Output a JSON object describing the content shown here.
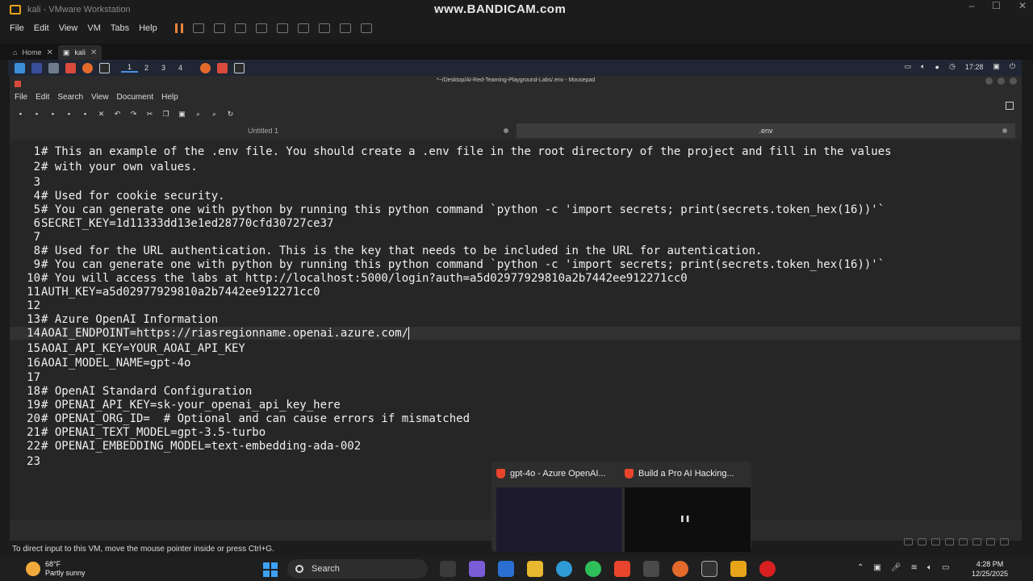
{
  "host": {
    "window_title": "kali - VMware Workstation",
    "watermark": "www.BANDICAM.com",
    "menu": [
      "File",
      "Edit",
      "View",
      "VM",
      "Tabs",
      "Help"
    ],
    "tabs": [
      {
        "label": "Home"
      },
      {
        "label": "kali"
      }
    ],
    "status_text": "To direct input to this VM, move the mouse pointer inside or press Ctrl+G."
  },
  "kali_panel": {
    "workspaces": [
      "1",
      "2",
      "3",
      "4"
    ],
    "clock": "17:28"
  },
  "mousepad": {
    "title": "*~/Desktop/AI-Red-Teaming-Playground-Labs/.env - Mousepad",
    "menu": [
      "File",
      "Edit",
      "Search",
      "View",
      "Document",
      "Help"
    ],
    "tabs": [
      {
        "label": "Untitled 1"
      },
      {
        "label": ".env"
      }
    ],
    "current_line": 14,
    "lines": [
      {
        "num": "1",
        "text": "# This an example of the .env file. You should create a .env file in the root directory of the project and fill in the values"
      },
      {
        "num": "2",
        "text": "# with your own values."
      },
      {
        "num": "3",
        "text": ""
      },
      {
        "num": "4",
        "text": "# Used for cookie security."
      },
      {
        "num": "5",
        "text": "# You can generate one with python by running this python command `python -c 'import secrets; print(secrets.token_hex(16))'`"
      },
      {
        "num": "6",
        "text": "SECRET_KEY=1d11333dd13e1ed28770cfd30727ce37"
      },
      {
        "num": "7",
        "text": ""
      },
      {
        "num": "8",
        "text": "# Used for the URL authentication. This is the key that needs to be included in the URL for autentication."
      },
      {
        "num": "9",
        "text": "# You can generate one with python by running this python command `python -c 'import secrets; print(secrets.token_hex(16))'`"
      },
      {
        "num": "10",
        "text": "# You will access the labs at http://localhost:5000/login?auth=a5d02977929810a2b7442ee912271cc0"
      },
      {
        "num": "11",
        "text": "AUTH_KEY=a5d02977929810a2b7442ee912271cc0"
      },
      {
        "num": "12",
        "text": ""
      },
      {
        "num": "13",
        "text": "# Azure OpenAI Information"
      },
      {
        "num": "14",
        "text": "AOAI_ENDPOINT=https://riasregionname.openai.azure.com/"
      },
      {
        "num": "15",
        "text": "AOAI_API_KEY=YOUR_AOAI_API_KEY"
      },
      {
        "num": "16",
        "text": "AOAI_MODEL_NAME=gpt-4o"
      },
      {
        "num": "17",
        "text": ""
      },
      {
        "num": "18",
        "text": "# OpenAI Standard Configuration"
      },
      {
        "num": "19",
        "text": "# OPENAI_API_KEY=sk-your_openai_api_key_here"
      },
      {
        "num": "20",
        "text": "# OPENAI_ORG_ID=  # Optional and can cause errors if mismatched"
      },
      {
        "num": "21",
        "text": "# OPENAI_TEXT_MODEL=gpt-3.5-turbo"
      },
      {
        "num": "22",
        "text": "# OPENAI_EMBEDDING_MODEL=text-embedding-ada-002"
      },
      {
        "num": "23",
        "text": ""
      }
    ]
  },
  "previews": [
    {
      "title": "gpt-4o - Azure OpenAI..."
    },
    {
      "title": "Build a Pro AI Hacking..."
    }
  ],
  "taskbar": {
    "weather_temp": "68°F",
    "weather_desc": "Partly sunny",
    "search_label": "Search",
    "time": "4:28 PM",
    "date": "12/25/2025"
  }
}
